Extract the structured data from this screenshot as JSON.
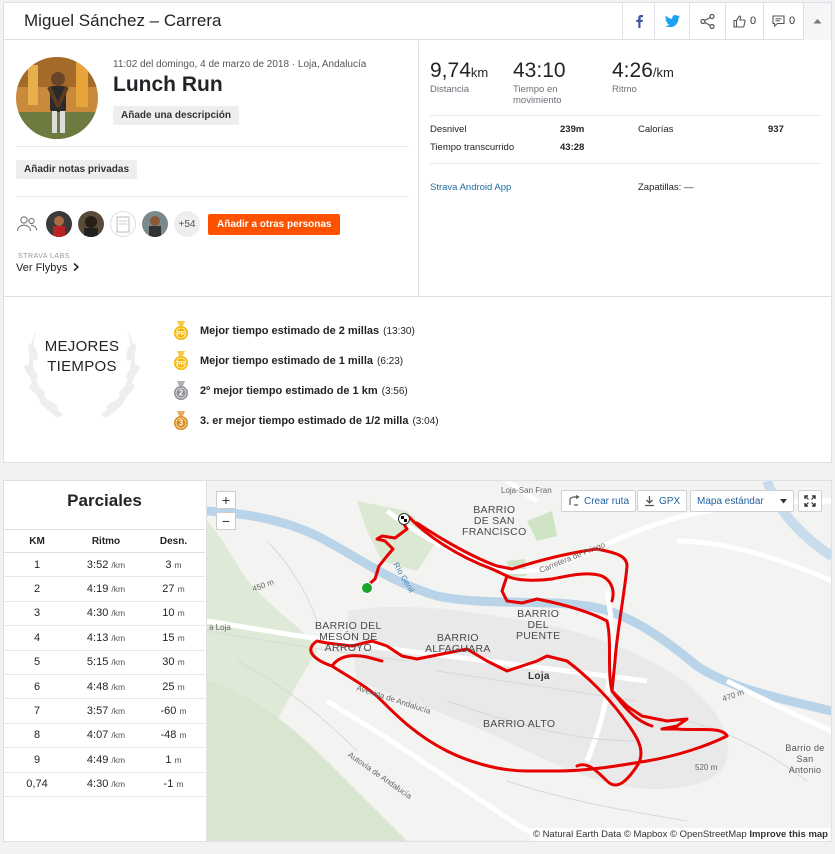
{
  "header": {
    "title": "Miguel Sánchez – Carrera",
    "kudos_count": "0",
    "comments_count": "0"
  },
  "activity": {
    "meta": "11:02 del domingo, 4 de marzo de 2018 · Loja, Andalucía",
    "title": "Lunch Run",
    "description_button": "Añade una descripción",
    "private_notes_button": "Añadir notas privadas",
    "more_athletes": "+54",
    "add_people_button": "Añadir a otras personas",
    "labs_label": "STRAVA LABS",
    "flyby_link": "Ver Flybys"
  },
  "stats": {
    "distance": {
      "value": "9,74",
      "unit": "km",
      "label": "Distancia"
    },
    "moving_time": {
      "value": "43:10",
      "label": "Tiempo en movimiento"
    },
    "pace": {
      "value": "4:26",
      "unit": "/km",
      "label": "Ritmo"
    },
    "elevation_label": "Desnivel",
    "elevation_value": "239m",
    "calories_label": "Calorías",
    "calories_value": "937",
    "elapsed_label": "Tiempo transcurrido",
    "elapsed_value": "43:28",
    "device": "Strava Android App",
    "shoes_label": "Zapatillas:",
    "shoes_value": "—"
  },
  "best_efforts": {
    "title_line1": "MEJORES",
    "title_line2": "TIEMPOS",
    "items": [
      {
        "label": "Mejor tiempo estimado de 2 millas",
        "time": "(13:30)",
        "medal": "PR",
        "color": "#f5b400"
      },
      {
        "label": "Mejor tiempo estimado de 1 milla",
        "time": "(6:23)",
        "medal": "PR",
        "color": "#f5b400"
      },
      {
        "label": "2º mejor tiempo estimado de 1 km",
        "time": "(3:56)",
        "medal": "2",
        "color": "#8e8e96"
      },
      {
        "label": "3. er mejor tiempo estimado de 1/2 milla",
        "time": "(3:04)",
        "medal": "3",
        "color": "#d88a1e"
      }
    ]
  },
  "splits": {
    "title": "Parciales",
    "headers": [
      "KM",
      "Ritmo",
      "Desn."
    ],
    "pace_unit": "/km",
    "elev_unit": "m",
    "rows": [
      {
        "km": "1",
        "pace": "3:52",
        "elev": "3"
      },
      {
        "km": "2",
        "pace": "4:19",
        "elev": "27"
      },
      {
        "km": "3",
        "pace": "4:30",
        "elev": "10"
      },
      {
        "km": "4",
        "pace": "4:13",
        "elev": "15"
      },
      {
        "km": "5",
        "pace": "5:15",
        "elev": "30"
      },
      {
        "km": "6",
        "pace": "4:48",
        "elev": "25"
      },
      {
        "km": "7",
        "pace": "3:57",
        "elev": "-60"
      },
      {
        "km": "8",
        "pace": "4:07",
        "elev": "-48"
      },
      {
        "km": "9",
        "pace": "4:49",
        "elev": "1"
      },
      {
        "km": "0,74",
        "pace": "4:30",
        "elev": "-1"
      }
    ]
  },
  "map": {
    "zoom_in": "+",
    "zoom_out": "−",
    "create_route": "Crear ruta",
    "gpx": "GPX",
    "map_style": "Mapa estándar",
    "labels": {
      "barrio_san_francisco_1": "BARRIO",
      "barrio_san_francisco_2": "DE SAN",
      "barrio_san_francisco_3": "FRANCISCO",
      "barrio_puente_1": "BARRIO",
      "barrio_puente_2": "DEL",
      "barrio_puente_3": "PUENTE",
      "barrio_meson_1": "BARRIO DEL",
      "barrio_meson_2": "MESÓN DE",
      "barrio_meson_3": "ARROYO",
      "barrio_alfaguara_1": "BARRIO",
      "barrio_alfaguara_2": "ALFAGUARA",
      "loja": "Loja",
      "barrio_alto": "BARRIO ALTO",
      "barrio_san_antonio_1": "Barrio de San",
      "barrio_san_antonio_2": "Antonio",
      "loja_san_francisco_road": "Loja-San Fran",
      "carretera_priego": "Carretera de Priego",
      "autovia": "Autovía de Andalucía",
      "avenida": "Avenida de Andalucía",
      "a_loja": "a Loja",
      "rio_genil": "Río Genil",
      "elev_450": "450 m",
      "elev_470": "470 m",
      "elev_520": "520 m"
    },
    "attribution_1": "© Natural Earth Data © Mapbox © OpenStreetMap",
    "attribution_2": "Improve this map",
    "route_color": "#e60000"
  }
}
